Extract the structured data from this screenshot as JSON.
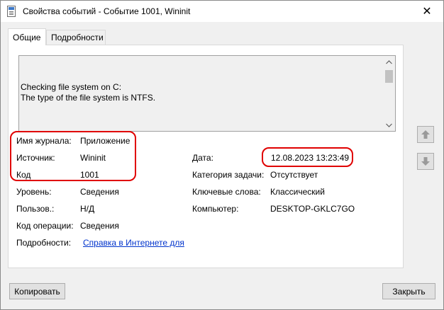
{
  "window": {
    "title": "Свойства событий - Событие 1001, Wininit",
    "close_glyph": "✕"
  },
  "tabs": [
    {
      "label": "Общие",
      "active": true
    },
    {
      "label": "Подробности",
      "active": false
    }
  ],
  "description": {
    "text": "Checking file system on C:\nThe type of the file system is NTFS."
  },
  "fields": {
    "log_name_label": "Имя журнала:",
    "log_name_value": "Приложение",
    "source_label": "Источник:",
    "source_value": "Wininit",
    "event_id_label": "Код",
    "event_id_value": "1001",
    "level_label": "Уровень:",
    "level_value": "Сведения",
    "user_label": "Пользов.:",
    "user_value": "Н/Д",
    "opcode_label": "Код операции:",
    "opcode_value": "Сведения",
    "more_info_label": "Подробности:",
    "more_info_link": "Справка в Интернете для",
    "date_label": "Дата:",
    "date_value": "12.08.2023 13:23:49",
    "task_category_label": "Категория задачи:",
    "task_category_value": "Отсутствует",
    "keywords_label": "Ключевые слова:",
    "keywords_value": "Классический",
    "computer_label": "Компьютер:",
    "computer_value": "DESKTOP-GKLC7GO"
  },
  "buttons": {
    "copy_label": "Копировать",
    "close_label": "Закрыть"
  },
  "icons": {
    "window": "event-properties-icon",
    "prev": "arrow-up-icon",
    "next": "arrow-down-icon"
  },
  "colors": {
    "highlight": "#e00000",
    "link": "#0033cc"
  }
}
